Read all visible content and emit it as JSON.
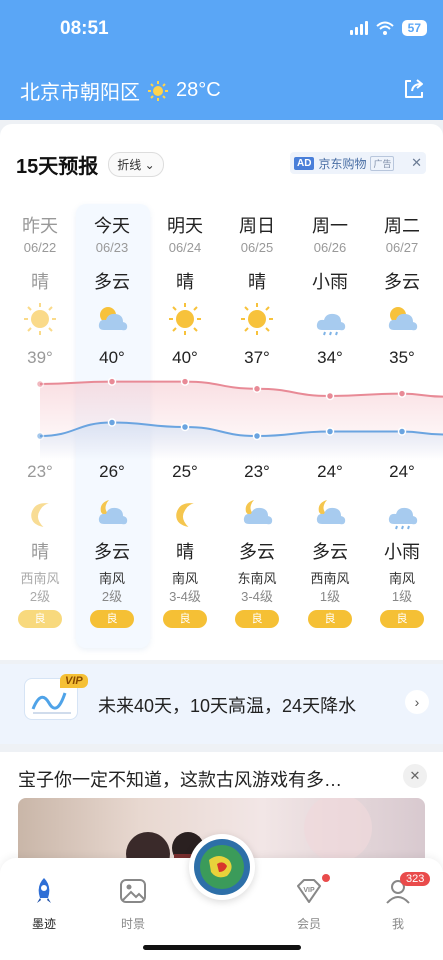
{
  "status_bar": {
    "time": "08:51",
    "battery": "57"
  },
  "header": {
    "location": "北京市朝阳区",
    "temp": "28°C"
  },
  "forecast": {
    "title": "15天预报",
    "view_toggle": "折线",
    "ad": {
      "tag": "AD",
      "brand": "京东购物",
      "label": "广告"
    },
    "days": [
      {
        "name": "昨天",
        "date": "06/22",
        "day_cond": "晴",
        "day_icon": "sun-icon",
        "high": "39°",
        "low": "23°",
        "night_icon": "moon-icon",
        "night_cond": "晴",
        "wind_dir": "西南风",
        "wind_level": "2级",
        "aqi": "良"
      },
      {
        "name": "今天",
        "date": "06/23",
        "day_cond": "多云",
        "day_icon": "partly-cloudy-icon",
        "high": "40°",
        "low": "26°",
        "night_icon": "cloudy-night-icon",
        "night_cond": "多云",
        "wind_dir": "南风",
        "wind_level": "2级",
        "aqi": "良"
      },
      {
        "name": "明天",
        "date": "06/24",
        "day_cond": "晴",
        "day_icon": "sun-icon",
        "high": "40°",
        "low": "25°",
        "night_icon": "moon-icon",
        "night_cond": "晴",
        "wind_dir": "南风",
        "wind_level": "3-4级",
        "aqi": "良"
      },
      {
        "name": "周日",
        "date": "06/25",
        "day_cond": "晴",
        "day_icon": "sun-icon",
        "high": "37°",
        "low": "23°",
        "night_icon": "cloudy-night-icon",
        "night_cond": "多云",
        "wind_dir": "东南风",
        "wind_level": "3-4级",
        "aqi": "良"
      },
      {
        "name": "周一",
        "date": "06/26",
        "day_cond": "小雨",
        "day_icon": "rain-icon",
        "high": "34°",
        "low": "24°",
        "night_icon": "cloudy-night-icon",
        "night_cond": "多云",
        "wind_dir": "西南风",
        "wind_level": "1级",
        "aqi": "良"
      },
      {
        "name": "周二",
        "date": "06/27",
        "day_cond": "多云",
        "day_icon": "partly-cloudy-icon",
        "high": "35°",
        "low": "24°",
        "night_icon": "rain-icon",
        "night_cond": "小雨",
        "wind_dir": "南风",
        "wind_level": "1级",
        "aqi": "良"
      }
    ],
    "high_values": [
      39,
      40,
      40,
      37,
      34,
      35
    ],
    "low_values": [
      23,
      26,
      25,
      23,
      24,
      24
    ],
    "colors": {
      "high_line": "#e88a96",
      "low_line": "#6aa4e0",
      "aqi": "#f5c035"
    }
  },
  "banner": {
    "vip": "VIP",
    "text": "未来40天，10天高温，24天降水"
  },
  "article": {
    "title": "宝子你一定不知道，这款古风游戏有多…"
  },
  "tabbar": {
    "tabs": [
      {
        "label": "墨迹",
        "icon": "rocket-icon"
      },
      {
        "label": "时景",
        "icon": "image-icon"
      },
      {
        "label": "会员",
        "icon": "vip-icon"
      },
      {
        "label": "我",
        "icon": "user-icon"
      }
    ],
    "badge": "323"
  }
}
